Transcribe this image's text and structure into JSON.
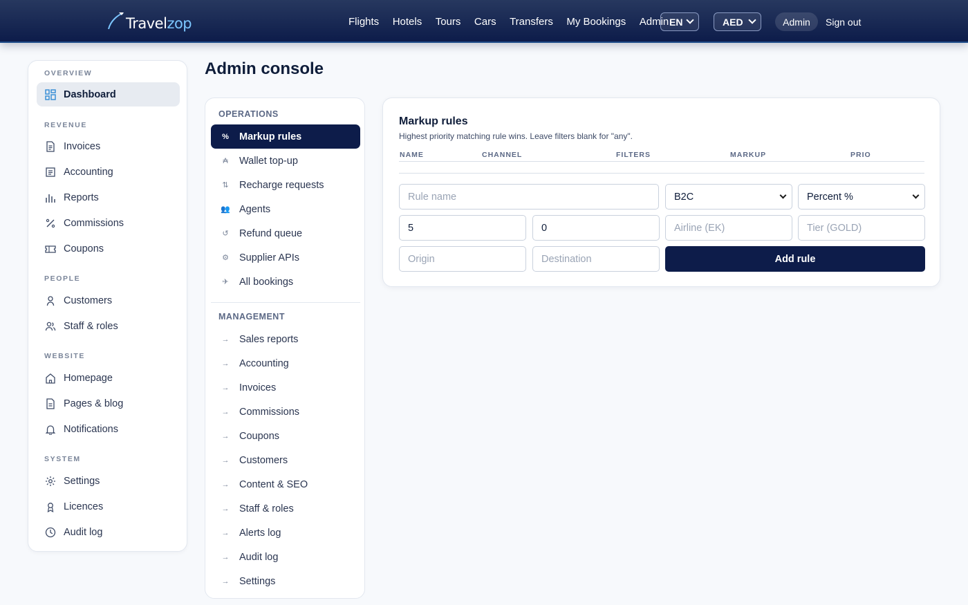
{
  "brand": {
    "name_main": "Travel",
    "name_accent": "zop"
  },
  "nav": {
    "links": [
      "Flights",
      "Hotels",
      "Tours",
      "Cars",
      "Transfers",
      "My Bookings",
      "Admin"
    ],
    "language": "EN",
    "currency": "AED",
    "user": "Admin",
    "signout": "Sign out"
  },
  "sidebar": {
    "sections": [
      {
        "title": "OVERVIEW",
        "items": [
          {
            "label": "Dashboard",
            "icon": "dashboard-icon",
            "active": true
          }
        ]
      },
      {
        "title": "REVENUE",
        "items": [
          {
            "label": "Invoices",
            "icon": "invoice-icon"
          },
          {
            "label": "Accounting",
            "icon": "ledger-icon"
          },
          {
            "label": "Reports",
            "icon": "bar-chart-icon"
          },
          {
            "label": "Commissions",
            "icon": "percent-icon"
          },
          {
            "label": "Coupons",
            "icon": "ticket-icon"
          }
        ]
      },
      {
        "title": "PEOPLE",
        "items": [
          {
            "label": "Customers",
            "icon": "user-icon"
          },
          {
            "label": "Staff & roles",
            "icon": "users-icon"
          }
        ]
      },
      {
        "title": "WEBSITE",
        "items": [
          {
            "label": "Homepage",
            "icon": "home-icon"
          },
          {
            "label": "Pages & blog",
            "icon": "document-icon"
          },
          {
            "label": "Notifications",
            "icon": "bell-icon"
          }
        ]
      },
      {
        "title": "SYSTEM",
        "items": [
          {
            "label": "Settings",
            "icon": "gear-icon"
          },
          {
            "label": "Licences",
            "icon": "award-icon"
          },
          {
            "label": "Audit log",
            "icon": "clock-icon"
          }
        ]
      }
    ]
  },
  "page": {
    "title": "Admin console"
  },
  "midmenu": {
    "operations_title": "OPERATIONS",
    "operations": [
      {
        "label": "Markup rules",
        "glyph": "%",
        "active": true
      },
      {
        "label": "Wallet top-up",
        "glyph": "₳"
      },
      {
        "label": "Recharge requests",
        "glyph": "⇅"
      },
      {
        "label": "Agents",
        "glyph": "👥"
      },
      {
        "label": "Refund queue",
        "glyph": "↺"
      },
      {
        "label": "Supplier APIs",
        "glyph": "⚙"
      },
      {
        "label": "All bookings",
        "glyph": "✈"
      }
    ],
    "management_title": "MANAGEMENT",
    "management": [
      {
        "label": "Sales reports",
        "glyph": "→"
      },
      {
        "label": "Accounting",
        "glyph": "→"
      },
      {
        "label": "Invoices",
        "glyph": "→"
      },
      {
        "label": "Commissions",
        "glyph": "→"
      },
      {
        "label": "Coupons",
        "glyph": "→"
      },
      {
        "label": "Customers",
        "glyph": "→"
      },
      {
        "label": "Content & SEO",
        "glyph": "→"
      },
      {
        "label": "Staff & roles",
        "glyph": "→"
      },
      {
        "label": "Alerts log",
        "glyph": "→"
      },
      {
        "label": "Audit log",
        "glyph": "→"
      },
      {
        "label": "Settings",
        "glyph": "→"
      }
    ]
  },
  "markup": {
    "title": "Markup rules",
    "subtitle": "Highest priority matching rule wins. Leave filters blank for \"any\".",
    "columns": [
      "NAME",
      "CHANNEL",
      "FILTERS",
      "MARKUP",
      "PRIO"
    ],
    "form": {
      "rule_name_placeholder": "Rule name",
      "channel": "B2C",
      "markup_type": "Percent %",
      "markup_value": "5",
      "priority_value": "0",
      "airline_placeholder": "Airline (EK)",
      "tier_placeholder": "Tier (GOLD)",
      "origin_placeholder": "Origin",
      "destination_placeholder": "Destination",
      "submit": "Add rule"
    }
  }
}
